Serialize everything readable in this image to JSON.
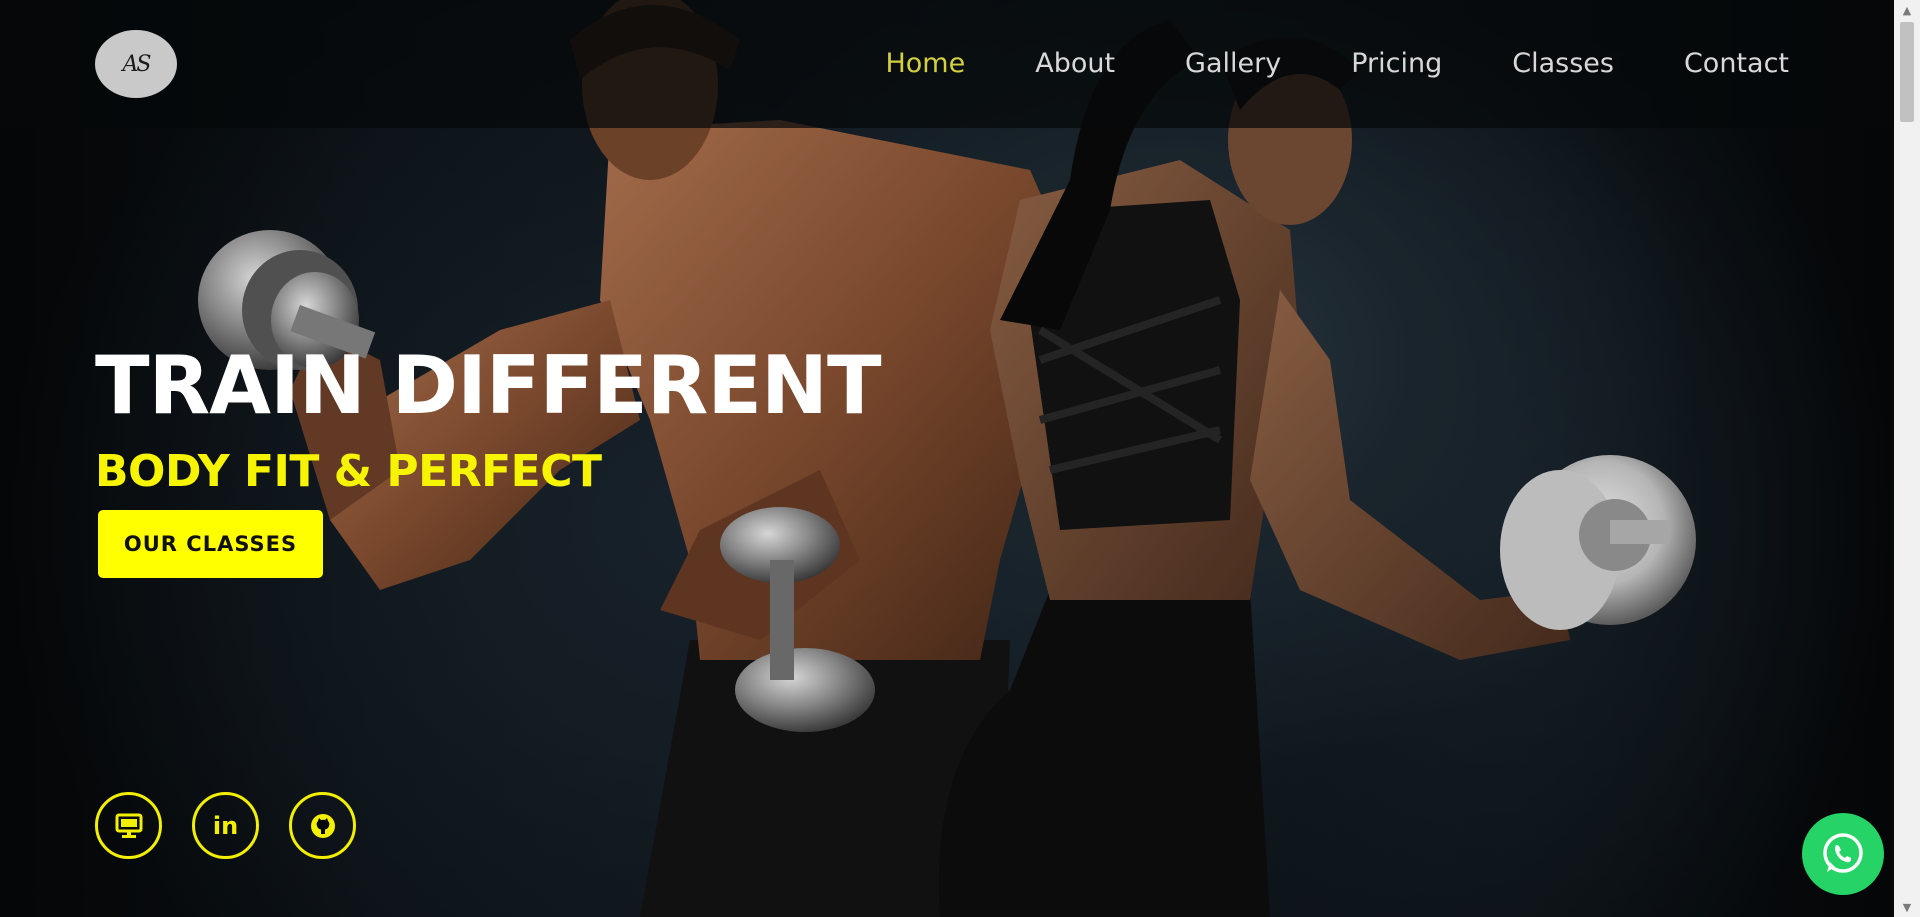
{
  "logo": {
    "text": "AS"
  },
  "nav": {
    "items": [
      {
        "label": "Home",
        "active": true
      },
      {
        "label": "About",
        "active": false
      },
      {
        "label": "Gallery",
        "active": false
      },
      {
        "label": "Pricing",
        "active": false
      },
      {
        "label": "Classes",
        "active": false
      },
      {
        "label": "Contact",
        "active": false
      }
    ]
  },
  "hero": {
    "headline": "TRAIN DIFFERENT",
    "subheadline": "BODY FIT & PERFECT",
    "cta_label": "OUR CLASSES",
    "image": "man-and-woman-lifting-dumbbells"
  },
  "socials": {
    "items": [
      {
        "icon": "monitor-icon"
      },
      {
        "icon": "linkedin-icon",
        "text": "in"
      },
      {
        "icon": "github-icon"
      }
    ]
  },
  "floating": {
    "icon": "whatsapp-icon"
  },
  "colors": {
    "accent": "#ffff00",
    "nav_active": "#d4d042",
    "whatsapp": "#25d366",
    "nav_bg": "#06080a"
  }
}
